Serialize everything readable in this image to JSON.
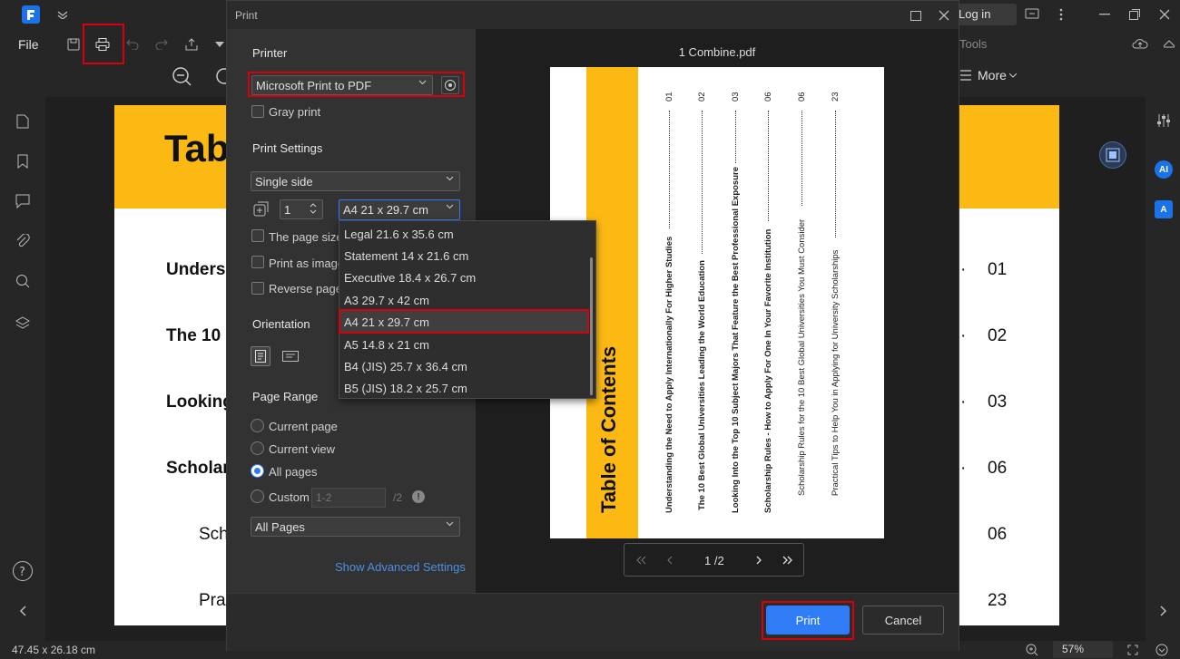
{
  "app": {
    "menu_file": "File",
    "login": "Log in",
    "tools": "Tools",
    "more": "More",
    "status_size": "47.45 x 26.18 cm",
    "zoom": "57%"
  },
  "document": {
    "title_partial": "Tab",
    "lines": [
      "Unders",
      "The 10",
      "Looking",
      "Scholar",
      "Sch",
      "Pra"
    ],
    "numbers": [
      "01",
      "02",
      "03",
      "06",
      "06",
      "23"
    ]
  },
  "dialog": {
    "title": "Print",
    "printer_heading": "Printer",
    "printer_value": "Microsoft Print to PDF",
    "gray_print": "Gray print",
    "settings_heading": "Print Settings",
    "sides_value": "Single side",
    "copies_value": "1",
    "paper_value": "A4 21 x 29.7 cm",
    "opt_page_size": "The page size",
    "opt_print_image": "Print as image",
    "opt_reverse": "Reverse pages",
    "orientation_heading": "Orientation",
    "range_heading": "Page Range",
    "range_current_page": "Current page",
    "range_current_view": "Current view",
    "range_all_pages": "All pages",
    "range_custom": "Custom",
    "custom_placeholder": "1-2",
    "custom_total": "/2",
    "subset_value": "All Pages",
    "advanced_link": "Show Advanced Settings",
    "paper_options": [
      "Legal 21.6 x 35.6 cm",
      "Statement 14 x 21.6 cm",
      "Executive 18.4 x 26.7 cm",
      "A3 29.7 x 42 cm",
      "A4 21 x 29.7 cm",
      "A5 14.8 x 21 cm",
      "B4 (JIS) 25.7 x 36.4 cm",
      "B5 (JIS) 18.2 x 25.7 cm"
    ],
    "preview_filename": "1 Combine.pdf",
    "preview_title": "Table of Contents",
    "preview_entries": [
      {
        "text": "Understanding the Need to Apply Internationally For Higher Studies",
        "num": "01",
        "bold": true
      },
      {
        "text": "The 10 Best Global Universities Leading the World Education",
        "num": "02",
        "bold": true
      },
      {
        "text": "Looking Into the Top 10 Subject Majors That Feature the Best Professional Exposure",
        "num": "03",
        "bold": true
      },
      {
        "text": "Scholarship Rules - How to Apply For One In Your Favorite Institution",
        "num": "06",
        "bold": true
      },
      {
        "text": "Scholarship Rules for the 10 Best Global Universities You Must Consider",
        "num": "06",
        "bold": false
      },
      {
        "text": "Practical Tips to Help You in Applying for University Scholarships",
        "num": "23",
        "bold": false
      }
    ],
    "page_indicator": "1 /2",
    "print_label": "Print",
    "cancel_label": "Cancel"
  },
  "colors": {
    "accent": "#2f7cf6",
    "highlight": "#d8000c",
    "doc_yellow": "#fdb913"
  }
}
